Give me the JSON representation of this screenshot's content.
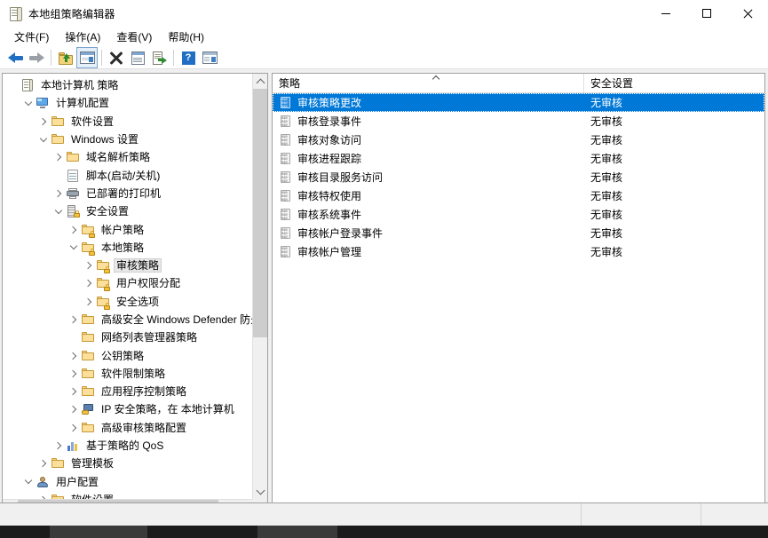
{
  "window": {
    "title": "本地组策略编辑器",
    "title_icon": "policy-document-icon",
    "minimize_label": "最小化",
    "maximize_label": "最大化",
    "close_label": "关闭"
  },
  "menubar": {
    "items": [
      {
        "label": "文件(F)",
        "name": "menu-file"
      },
      {
        "label": "操作(A)",
        "name": "menu-action"
      },
      {
        "label": "查看(V)",
        "name": "menu-view"
      },
      {
        "label": "帮助(H)",
        "name": "menu-help"
      }
    ]
  },
  "toolbar": {
    "buttons": [
      {
        "name": "back-button",
        "icon": "back-arrow-icon",
        "label": "后退"
      },
      {
        "name": "forward-button",
        "icon": "forward-arrow-icon",
        "label": "前进"
      },
      {
        "name": "up-one-level-button",
        "icon": "folder-up-icon",
        "label": "向上一层"
      },
      {
        "name": "show-hide-tree-button",
        "icon": "console-tree-icon",
        "label": "显示/隐藏控制台树",
        "selected": true
      },
      {
        "name": "delete-button",
        "icon": "delete-x-icon",
        "label": "删除"
      },
      {
        "name": "properties-button",
        "icon": "properties-icon",
        "label": "属性"
      },
      {
        "name": "export-list-button",
        "icon": "export-list-icon",
        "label": "导出列表"
      },
      {
        "name": "help-button",
        "icon": "help-question-icon",
        "label": "帮助"
      },
      {
        "name": "view-window-button",
        "icon": "new-window-icon",
        "label": "新建窗口"
      }
    ]
  },
  "tree": {
    "items": [
      {
        "label": "本地计算机 策略",
        "indent": 0,
        "icon": "policy-document-icon",
        "expander": "none",
        "selected": false
      },
      {
        "label": "计算机配置",
        "indent": 1,
        "icon": "computer-monitor-icon",
        "expander": "open",
        "selected": false
      },
      {
        "label": "软件设置",
        "indent": 2,
        "icon": "folder-icon",
        "expander": "closed",
        "selected": false
      },
      {
        "label": "Windows 设置",
        "indent": 2,
        "icon": "folder-icon",
        "expander": "open",
        "selected": false
      },
      {
        "label": "域名解析策略",
        "indent": 3,
        "icon": "folder-icon",
        "expander": "closed",
        "selected": false
      },
      {
        "label": "脚本(启动/关机)",
        "indent": 3,
        "icon": "script-icon",
        "expander": "none",
        "selected": false
      },
      {
        "label": "已部署的打印机",
        "indent": 3,
        "icon": "printer-icon",
        "expander": "closed",
        "selected": false
      },
      {
        "label": "安全设置",
        "indent": 3,
        "icon": "security-settings-icon",
        "expander": "open",
        "selected": false
      },
      {
        "label": "帐户策略",
        "indent": 4,
        "icon": "folder-lock-icon",
        "expander": "closed",
        "selected": false
      },
      {
        "label": "本地策略",
        "indent": 4,
        "icon": "folder-lock-icon",
        "expander": "open",
        "selected": false
      },
      {
        "label": "审核策略",
        "indent": 5,
        "icon": "folder-lock-icon",
        "expander": "closed",
        "selected": true
      },
      {
        "label": "用户权限分配",
        "indent": 5,
        "icon": "folder-lock-icon",
        "expander": "closed",
        "selected": false
      },
      {
        "label": "安全选项",
        "indent": 5,
        "icon": "folder-lock-icon",
        "expander": "closed",
        "selected": false
      },
      {
        "label": "高级安全 Windows Defender 防火墙",
        "indent": 4,
        "icon": "folder-icon",
        "expander": "closed",
        "selected": false
      },
      {
        "label": "网络列表管理器策略",
        "indent": 4,
        "icon": "folder-icon",
        "expander": "none",
        "selected": false
      },
      {
        "label": "公钥策略",
        "indent": 4,
        "icon": "folder-icon",
        "expander": "closed",
        "selected": false
      },
      {
        "label": "软件限制策略",
        "indent": 4,
        "icon": "folder-icon",
        "expander": "closed",
        "selected": false
      },
      {
        "label": "应用程序控制策略",
        "indent": 4,
        "icon": "folder-icon",
        "expander": "closed",
        "selected": false
      },
      {
        "label": "IP 安全策略，在 本地计算机",
        "indent": 4,
        "icon": "ip-security-icon",
        "expander": "closed",
        "selected": false
      },
      {
        "label": "高级审核策略配置",
        "indent": 4,
        "icon": "folder-icon",
        "expander": "closed",
        "selected": false
      },
      {
        "label": "基于策略的 QoS",
        "indent": 3,
        "icon": "qos-chart-icon",
        "expander": "closed",
        "selected": false
      },
      {
        "label": "管理模板",
        "indent": 2,
        "icon": "folder-icon",
        "expander": "closed",
        "selected": false
      },
      {
        "label": "用户配置",
        "indent": 1,
        "icon": "user-icon",
        "expander": "open",
        "selected": false
      },
      {
        "label": "软件设置",
        "indent": 2,
        "icon": "folder-icon",
        "expander": "closed",
        "selected": false
      }
    ]
  },
  "list": {
    "columns": [
      {
        "label": "策略",
        "name": "column-policy",
        "sorted": "asc"
      },
      {
        "label": "安全设置",
        "name": "column-security-setting",
        "sorted": "none"
      }
    ],
    "rows": [
      {
        "policy": "审核策略更改",
        "setting": "无审核",
        "selected": true
      },
      {
        "policy": "审核登录事件",
        "setting": "无审核",
        "selected": false
      },
      {
        "policy": "审核对象访问",
        "setting": "无审核",
        "selected": false
      },
      {
        "policy": "审核进程跟踪",
        "setting": "无审核",
        "selected": false
      },
      {
        "policy": "审核目录服务访问",
        "setting": "无审核",
        "selected": false
      },
      {
        "policy": "审核特权使用",
        "setting": "无审核",
        "selected": false
      },
      {
        "policy": "审核系统事件",
        "setting": "无审核",
        "selected": false
      },
      {
        "policy": "审核帐户登录事件",
        "setting": "无审核",
        "selected": false
      },
      {
        "policy": "审核帐户管理",
        "setting": "无审核",
        "selected": false
      }
    ]
  },
  "status": {
    "segment1": "",
    "segment2": "",
    "segment3": ""
  },
  "colors": {
    "selection_blue": "#0078d7",
    "tree_selection_gray": "#e8e8e8",
    "window_bg": "#f0f0f0",
    "pane_bg": "#ffffff",
    "border": "#a0a0a0"
  }
}
